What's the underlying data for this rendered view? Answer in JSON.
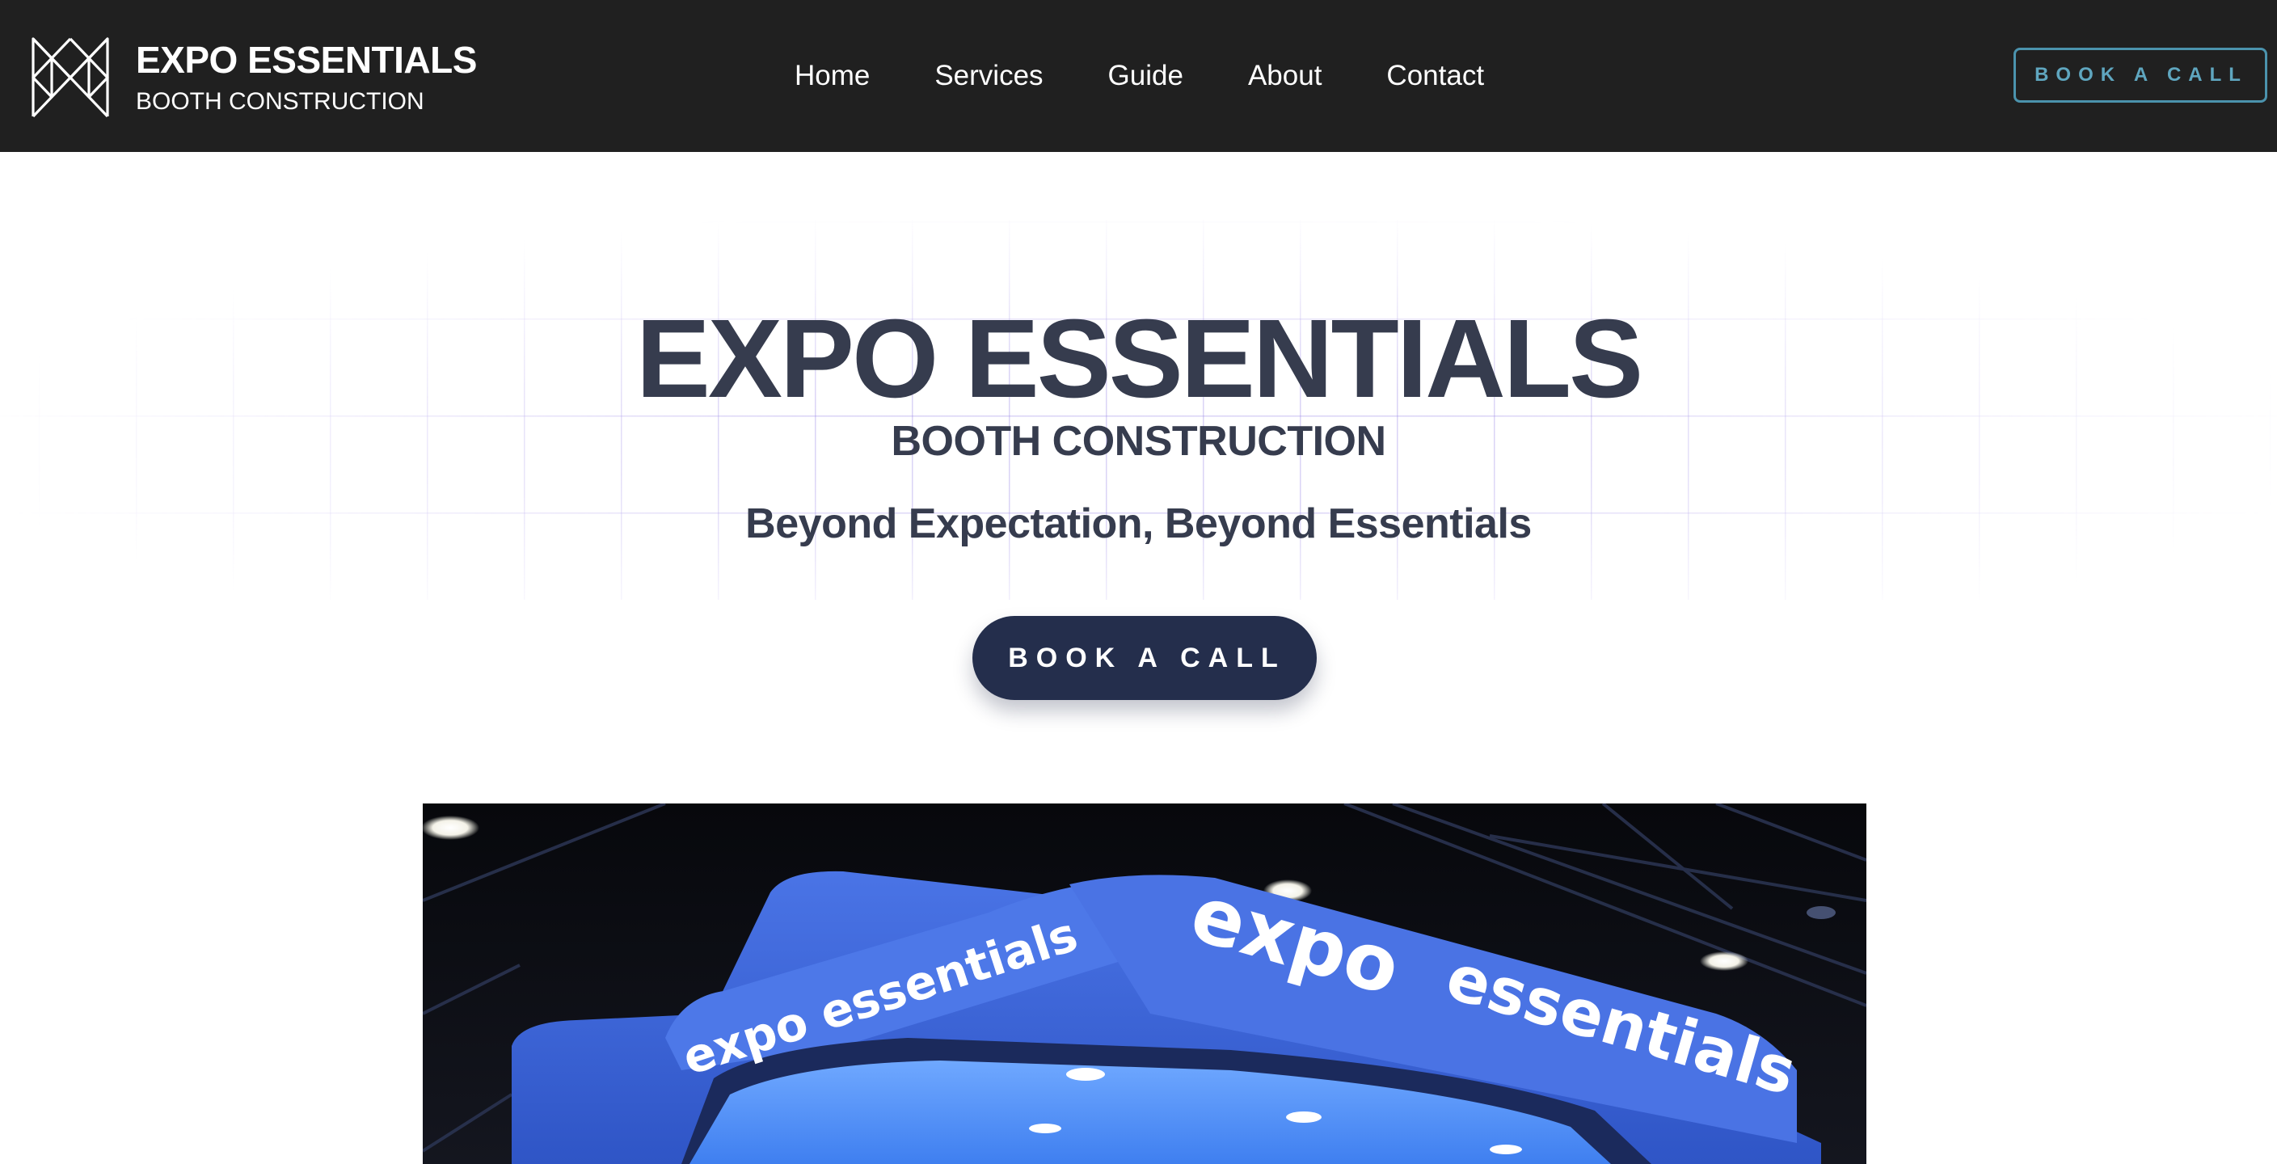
{
  "navbar": {
    "brand_title": "EXPO ESSENTIALS",
    "brand_subtitle": "BOOTH CONSTRUCTION",
    "logo_icon": "expo-essentials-logo-icon",
    "links": [
      {
        "label": "Home"
      },
      {
        "label": "Services"
      },
      {
        "label": "Guide"
      },
      {
        "label": "About"
      },
      {
        "label": "Contact"
      }
    ],
    "cta_label": "BOOK A CALL",
    "cta_color": "#4b93ad",
    "background_color": "#202020"
  },
  "hero": {
    "title": "EXPO ESSENTIALS",
    "subtitle": "BOOTH CONSTRUCTION",
    "tagline": "Beyond Expectation, Beyond Essentials",
    "cta_label": "BOOK A CALL",
    "cta_color": "#242e4c",
    "text_color": "#363c4e"
  },
  "showcase": {
    "sign_text_left": "expo essentials",
    "sign_text_right_1": "expo",
    "sign_text_right_2": "essentials",
    "booth_color": "#3a64d8"
  }
}
